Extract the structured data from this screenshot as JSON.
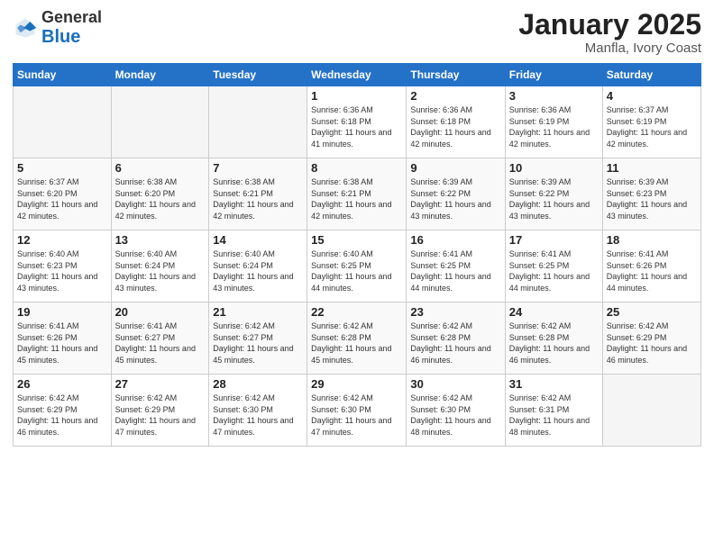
{
  "logo": {
    "general": "General",
    "blue": "Blue"
  },
  "header": {
    "month": "January 2025",
    "location": "Manfla, Ivory Coast"
  },
  "weekdays": [
    "Sunday",
    "Monday",
    "Tuesday",
    "Wednesday",
    "Thursday",
    "Friday",
    "Saturday"
  ],
  "weeks": [
    [
      {
        "day": "",
        "info": ""
      },
      {
        "day": "",
        "info": ""
      },
      {
        "day": "",
        "info": ""
      },
      {
        "day": "1",
        "info": "Sunrise: 6:36 AM\nSunset: 6:18 PM\nDaylight: 11 hours and 41 minutes."
      },
      {
        "day": "2",
        "info": "Sunrise: 6:36 AM\nSunset: 6:18 PM\nDaylight: 11 hours and 42 minutes."
      },
      {
        "day": "3",
        "info": "Sunrise: 6:36 AM\nSunset: 6:19 PM\nDaylight: 11 hours and 42 minutes."
      },
      {
        "day": "4",
        "info": "Sunrise: 6:37 AM\nSunset: 6:19 PM\nDaylight: 11 hours and 42 minutes."
      }
    ],
    [
      {
        "day": "5",
        "info": "Sunrise: 6:37 AM\nSunset: 6:20 PM\nDaylight: 11 hours and 42 minutes."
      },
      {
        "day": "6",
        "info": "Sunrise: 6:38 AM\nSunset: 6:20 PM\nDaylight: 11 hours and 42 minutes."
      },
      {
        "day": "7",
        "info": "Sunrise: 6:38 AM\nSunset: 6:21 PM\nDaylight: 11 hours and 42 minutes."
      },
      {
        "day": "8",
        "info": "Sunrise: 6:38 AM\nSunset: 6:21 PM\nDaylight: 11 hours and 42 minutes."
      },
      {
        "day": "9",
        "info": "Sunrise: 6:39 AM\nSunset: 6:22 PM\nDaylight: 11 hours and 43 minutes."
      },
      {
        "day": "10",
        "info": "Sunrise: 6:39 AM\nSunset: 6:22 PM\nDaylight: 11 hours and 43 minutes."
      },
      {
        "day": "11",
        "info": "Sunrise: 6:39 AM\nSunset: 6:23 PM\nDaylight: 11 hours and 43 minutes."
      }
    ],
    [
      {
        "day": "12",
        "info": "Sunrise: 6:40 AM\nSunset: 6:23 PM\nDaylight: 11 hours and 43 minutes."
      },
      {
        "day": "13",
        "info": "Sunrise: 6:40 AM\nSunset: 6:24 PM\nDaylight: 11 hours and 43 minutes."
      },
      {
        "day": "14",
        "info": "Sunrise: 6:40 AM\nSunset: 6:24 PM\nDaylight: 11 hours and 43 minutes."
      },
      {
        "day": "15",
        "info": "Sunrise: 6:40 AM\nSunset: 6:25 PM\nDaylight: 11 hours and 44 minutes."
      },
      {
        "day": "16",
        "info": "Sunrise: 6:41 AM\nSunset: 6:25 PM\nDaylight: 11 hours and 44 minutes."
      },
      {
        "day": "17",
        "info": "Sunrise: 6:41 AM\nSunset: 6:25 PM\nDaylight: 11 hours and 44 minutes."
      },
      {
        "day": "18",
        "info": "Sunrise: 6:41 AM\nSunset: 6:26 PM\nDaylight: 11 hours and 44 minutes."
      }
    ],
    [
      {
        "day": "19",
        "info": "Sunrise: 6:41 AM\nSunset: 6:26 PM\nDaylight: 11 hours and 45 minutes."
      },
      {
        "day": "20",
        "info": "Sunrise: 6:41 AM\nSunset: 6:27 PM\nDaylight: 11 hours and 45 minutes."
      },
      {
        "day": "21",
        "info": "Sunrise: 6:42 AM\nSunset: 6:27 PM\nDaylight: 11 hours and 45 minutes."
      },
      {
        "day": "22",
        "info": "Sunrise: 6:42 AM\nSunset: 6:28 PM\nDaylight: 11 hours and 45 minutes."
      },
      {
        "day": "23",
        "info": "Sunrise: 6:42 AM\nSunset: 6:28 PM\nDaylight: 11 hours and 46 minutes."
      },
      {
        "day": "24",
        "info": "Sunrise: 6:42 AM\nSunset: 6:28 PM\nDaylight: 11 hours and 46 minutes."
      },
      {
        "day": "25",
        "info": "Sunrise: 6:42 AM\nSunset: 6:29 PM\nDaylight: 11 hours and 46 minutes."
      }
    ],
    [
      {
        "day": "26",
        "info": "Sunrise: 6:42 AM\nSunset: 6:29 PM\nDaylight: 11 hours and 46 minutes."
      },
      {
        "day": "27",
        "info": "Sunrise: 6:42 AM\nSunset: 6:29 PM\nDaylight: 11 hours and 47 minutes."
      },
      {
        "day": "28",
        "info": "Sunrise: 6:42 AM\nSunset: 6:30 PM\nDaylight: 11 hours and 47 minutes."
      },
      {
        "day": "29",
        "info": "Sunrise: 6:42 AM\nSunset: 6:30 PM\nDaylight: 11 hours and 47 minutes."
      },
      {
        "day": "30",
        "info": "Sunrise: 6:42 AM\nSunset: 6:30 PM\nDaylight: 11 hours and 48 minutes."
      },
      {
        "day": "31",
        "info": "Sunrise: 6:42 AM\nSunset: 6:31 PM\nDaylight: 11 hours and 48 minutes."
      },
      {
        "day": "",
        "info": ""
      }
    ]
  ]
}
